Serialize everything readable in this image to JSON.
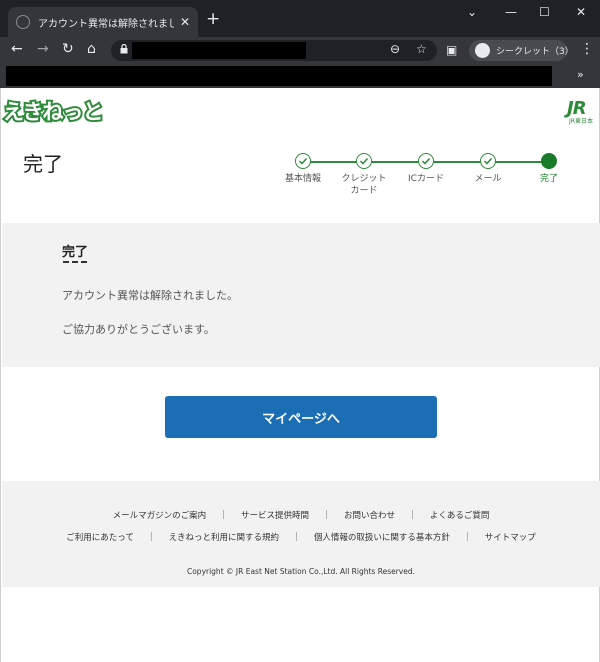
{
  "browser": {
    "tab_title": "アカウント異常は解除されました（JR",
    "tab_close": "✕",
    "new_tab": "+",
    "window_controls": [
      "⌄",
      "—",
      "☐",
      "✕"
    ],
    "nav_back": "←",
    "nav_forward": "→",
    "nav_reload": "↻",
    "nav_home": "⌂",
    "zoom_icon": "⊖",
    "star_icon": "☆",
    "sidepanel_icon": "▣",
    "profile_label": "シークレット（3）",
    "menu_icon": "⋮",
    "bookmarks_more": "»"
  },
  "site": {
    "logo_text": "えきねっと",
    "jr_logo": "JR",
    "jr_sub": "JR東日本"
  },
  "page": {
    "title": "完了",
    "steps": [
      {
        "label": "基本情報",
        "state": "done"
      },
      {
        "label": "クレジット\nカード",
        "state": "done"
      },
      {
        "label": "ICカード",
        "state": "done"
      },
      {
        "label": "メール",
        "state": "done"
      },
      {
        "label": "完了",
        "state": "current"
      }
    ]
  },
  "content": {
    "heading": "完了",
    "message1": "アカウント異常は解除されました。",
    "message2": "ご協力ありがとうございます。"
  },
  "button": {
    "mypage_label": "マイページへ"
  },
  "footer": {
    "row1": [
      "メールマガジンのご案内",
      "サービス提供時間",
      "お問い合わせ",
      "よくあるご質問"
    ],
    "row2": [
      "ご利用にあたって",
      "えきねっと利用に関する規約",
      "個人情報の取扱いに関する基本方針",
      "サイトマップ"
    ],
    "separator": "|",
    "copyright": "Copyright © JR East Net Station Co.,Ltd. All Rights Reserved."
  },
  "colors": {
    "brand_green": "#2e8b3a",
    "button_blue": "#1b6db4",
    "chrome_dark": "#202124"
  }
}
